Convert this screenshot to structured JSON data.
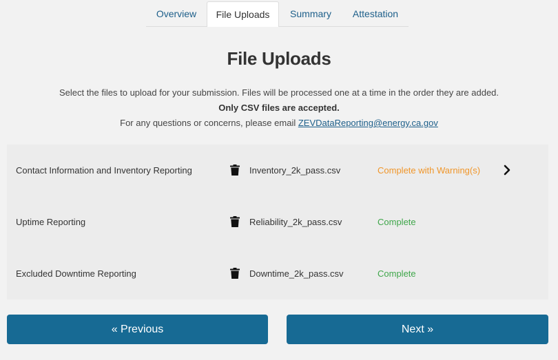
{
  "tabs": [
    {
      "label": "Overview"
    },
    {
      "label": "File Uploads"
    },
    {
      "label": "Summary"
    },
    {
      "label": "Attestation"
    }
  ],
  "page": {
    "title": "File Uploads",
    "desc_line1": "Select the files to upload for your submission. Files will be processed one at a time in the order they are added.",
    "desc_line2": "Only CSV files are accepted.",
    "desc_line3_prefix": "For any questions or concerns, please email",
    "contact_email": "ZEVDataReporting@energy.ca.gov"
  },
  "uploads": [
    {
      "label": "Contact Information and Inventory Reporting",
      "file": "Inventory_2k_pass.csv",
      "status": "Complete with Warning(s)"
    },
    {
      "label": "Uptime Reporting",
      "file": "Reliability_2k_pass.csv",
      "status": "Complete"
    },
    {
      "label": "Excluded Downtime Reporting",
      "file": "Downtime_2k_pass.csv",
      "status": "Complete"
    }
  ],
  "colors": {
    "accent": "#176a94",
    "link": "#1d5f8a",
    "warning": "#f0962a",
    "success": "#3fa64a"
  },
  "nav": {
    "previous_label": "« Previous",
    "next_label": "Next »"
  }
}
